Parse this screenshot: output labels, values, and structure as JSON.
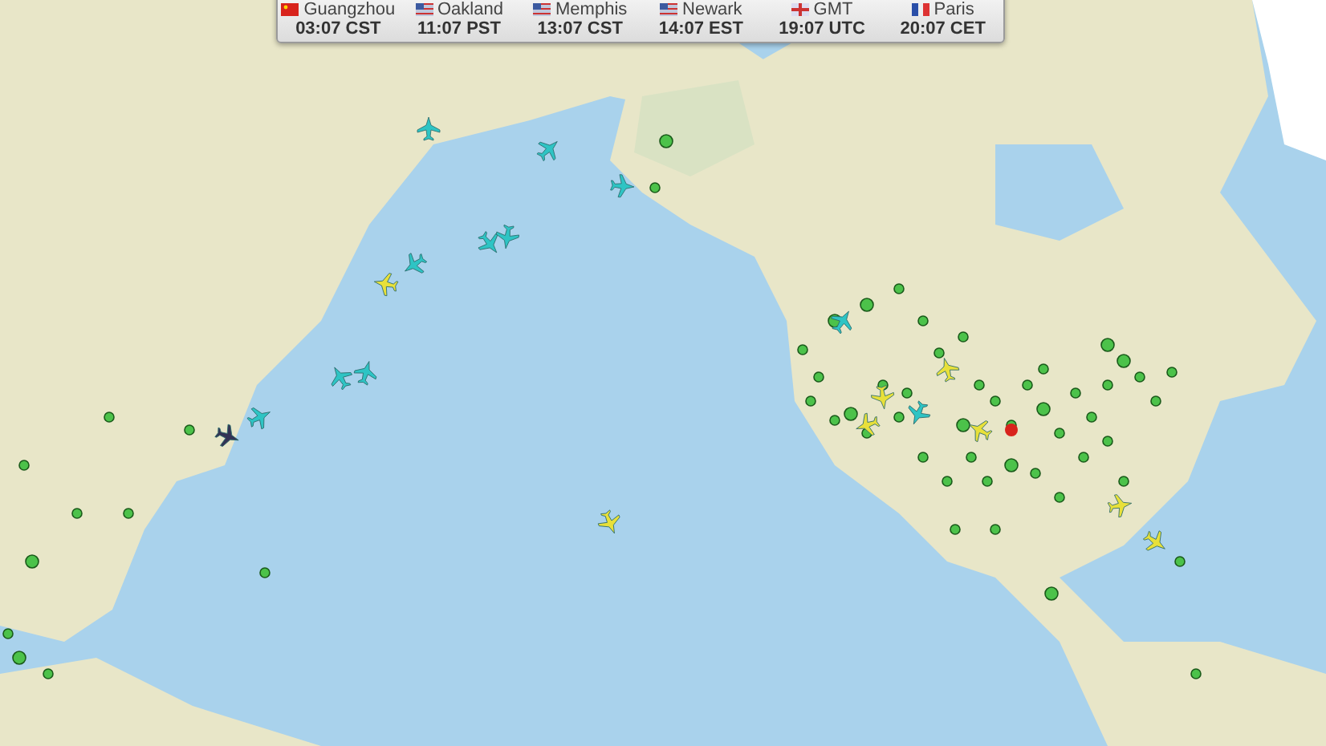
{
  "clocks": [
    {
      "city": "Guangzhou",
      "time": "03:07 CST",
      "kind": "china"
    },
    {
      "city": "Oakland",
      "time": "11:07 PST",
      "kind": "usa"
    },
    {
      "city": "Memphis",
      "time": "13:07 CST",
      "kind": "usa"
    },
    {
      "city": "Newark",
      "time": "14:07 EST",
      "kind": "usa"
    },
    {
      "city": "GMT",
      "time": "19:07 UTC",
      "kind": "uk"
    },
    {
      "city": "Paris",
      "time": "20:07 CET",
      "kind": "france"
    }
  ]
}
